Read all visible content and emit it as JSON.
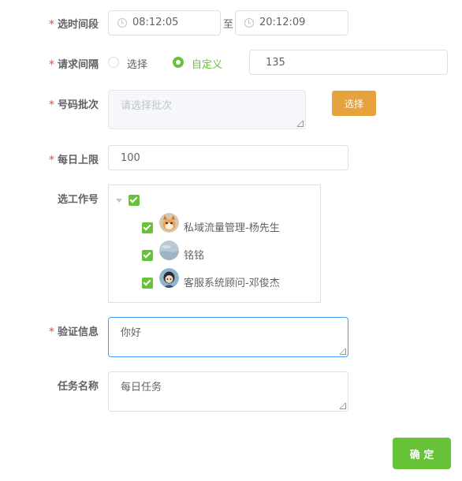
{
  "form": {
    "time_range": {
      "label": "选时间段",
      "start": "08:12:05",
      "separator": "至",
      "end": "20:12:09"
    },
    "interval": {
      "label": "请求间隔",
      "option_select": "选择",
      "option_custom": "自定义",
      "selected": "自定义",
      "value": "135"
    },
    "batch": {
      "label": "号码批次",
      "placeholder": "请选择批次",
      "button": "选择"
    },
    "daily_limit": {
      "label": "每日上限",
      "value": "100"
    },
    "workers": {
      "label": "选工作号",
      "items": [
        {
          "name": "私域流量管理-杨先生",
          "checked": true,
          "avatar": "dog-avatar"
        },
        {
          "name": "铭铭",
          "checked": true,
          "avatar": "sky-avatar"
        },
        {
          "name": "客服系统顾问-邓俊杰",
          "checked": true,
          "avatar": "person-avatar"
        }
      ]
    },
    "verify": {
      "label": "验证信息",
      "value": "你好"
    },
    "task_name": {
      "label": "任务名称",
      "value": "每日任务"
    }
  },
  "actions": {
    "confirm": "确 定"
  },
  "colors": {
    "required": "#f56c6c",
    "accent_green": "#67c23a",
    "select_button": "#e6a23c",
    "focus_border": "#409eff"
  }
}
